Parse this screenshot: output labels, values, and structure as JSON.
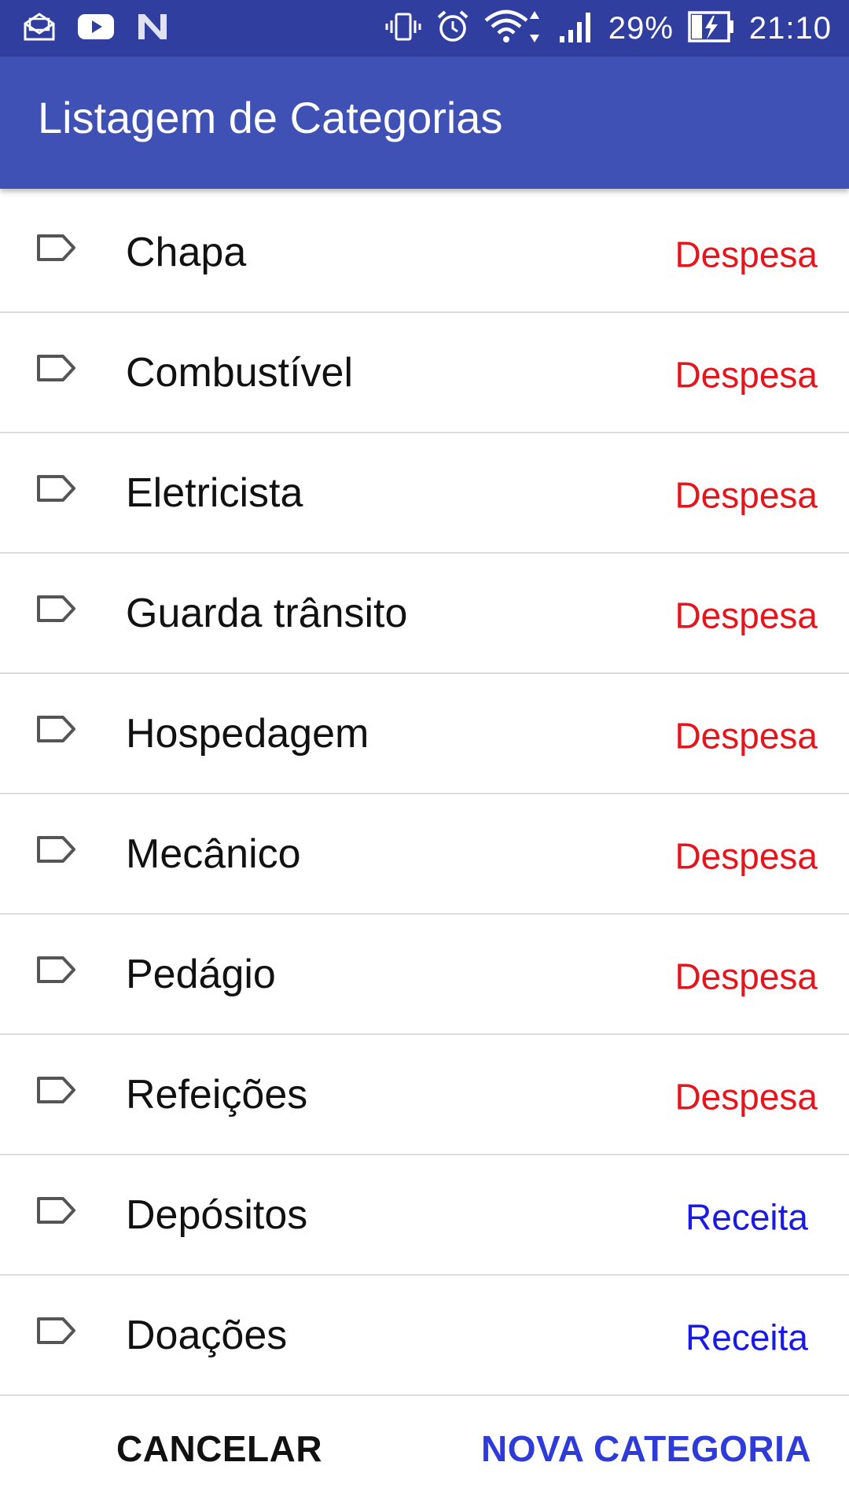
{
  "status_bar": {
    "battery_percent": "29%",
    "time": "21:10",
    "left_icons": [
      "mail-icon",
      "youtube-icon",
      "n-logo-icon"
    ],
    "right_icons": [
      "vibrate-icon",
      "alarm-icon",
      "wifi-icon",
      "signal-icon",
      "battery-charging-icon"
    ]
  },
  "app_bar": {
    "title": "Listagem de Categorias",
    "color": "#3F51B5"
  },
  "categories": [
    {
      "name": "Chapa",
      "type": "Despesa"
    },
    {
      "name": "Combustível",
      "type": "Despesa"
    },
    {
      "name": "Eletricista",
      "type": "Despesa"
    },
    {
      "name": "Guarda trânsito",
      "type": "Despesa"
    },
    {
      "name": "Hospedagem",
      "type": "Despesa"
    },
    {
      "name": "Mecânico",
      "type": "Despesa"
    },
    {
      "name": "Pedágio",
      "type": "Despesa"
    },
    {
      "name": "Refeições",
      "type": "Despesa"
    },
    {
      "name": "Depósitos",
      "type": "Receita"
    },
    {
      "name": "Doações",
      "type": "Receita"
    }
  ],
  "colors": {
    "despesa": "#E5151D",
    "receita": "#1A1AE6",
    "accent": "#2F3BD8"
  },
  "footer": {
    "cancel_label": "CANCELAR",
    "new_category_label": "NOVA CATEGORIA"
  }
}
